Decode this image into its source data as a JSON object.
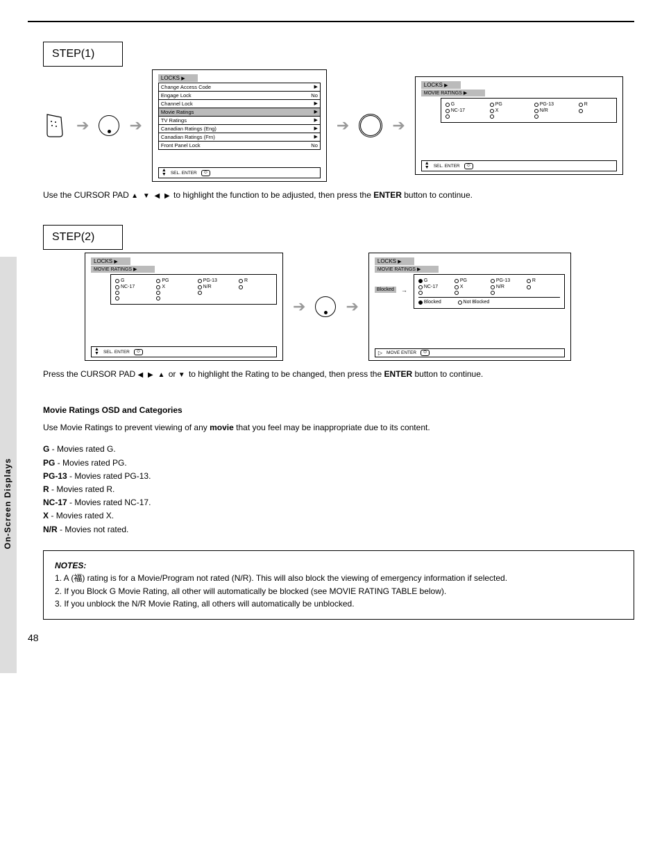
{
  "sideLabel": "On-Screen Displays",
  "pageNumber": "48",
  "step1": {
    "label": "STEP(1)",
    "caption_prefix": "Use the CURSOR PAD",
    "caption_arrows": "▲ ▼ ◀ ▶",
    "caption_mid": "to highlight the function to be adjusted, then press the ",
    "caption_btn": "ENTER",
    "caption_suffix": " button to continue.",
    "menuScreen": {
      "title": "LOCKS",
      "items": [
        {
          "label": "Change Access Code",
          "arrow": "▶"
        },
        {
          "label": "Engage Lock",
          "value": "No"
        },
        {
          "label": "Channel Lock",
          "arrow": "▶"
        },
        {
          "label": "Movie Ratings",
          "arrow": "▶",
          "selected": true
        },
        {
          "label": "TV Ratings",
          "arrow": "▶"
        },
        {
          "label": "Canadian Ratings (Eng)",
          "arrow": "▶"
        },
        {
          "label": "Canadian Ratings (Frn)",
          "arrow": "▶"
        },
        {
          "label": "Front Panel Lock",
          "value": "No"
        }
      ],
      "hint": "SEL.               ENTER"
    },
    "ratingsScreen": {
      "title": "LOCKS",
      "subtitle": "MOVIE RATINGS",
      "rows": [
        [
          {
            "t": "G"
          },
          {
            "t": "PG"
          },
          {
            "t": "PG-13"
          },
          {
            "t": "R"
          }
        ],
        [
          {
            "t": "NC-17"
          },
          {
            "t": "X"
          },
          {
            "t": "N/R"
          },
          {
            "t": ""
          }
        ],
        [
          {
            "t": ""
          },
          {
            "t": ""
          },
          {
            "t": ""
          },
          {
            "t": ""
          }
        ]
      ],
      "hint": "SEL.               ENTER"
    }
  },
  "step2": {
    "label": "STEP(2)",
    "caption_prefix": "Press the CURSOR PAD",
    "caption_arrows": "◀ ▶ ▲",
    "caption_or": "or",
    "caption_arrow2": "▼",
    "caption_mid": " to highlight the Rating to be changed, then press the ",
    "caption_btn": "ENTER",
    "caption_suffix": " button to continue.",
    "screenLeft": {
      "title": "LOCKS",
      "subtitle": "MOVIE RATINGS",
      "rows4": [
        [
          {
            "t": "G"
          },
          {
            "t": "PG"
          },
          {
            "t": "PG-13"
          },
          {
            "t": "R"
          }
        ],
        [
          {
            "t": "NC-17"
          },
          {
            "t": "X"
          },
          {
            "t": "N/R"
          },
          {
            "t": ""
          }
        ],
        [
          {
            "t": ""
          },
          {
            "t": ""
          },
          {
            "t": ""
          },
          {
            "t": ""
          }
        ],
        [
          {
            "t": ""
          },
          {
            "t": ""
          },
          {
            "t": ""
          },
          {
            "t": ""
          }
        ]
      ],
      "hint": "SEL.               ENTER"
    },
    "screenRight": {
      "title": "LOCKS",
      "subtitle": "MOVIE RATINGS",
      "blockedLabel": "Blocked",
      "moveArrow": "→",
      "rows4": [
        [
          {
            "t": "G",
            "on": true
          },
          {
            "t": "PG"
          },
          {
            "t": "PG-13"
          },
          {
            "t": "R"
          }
        ],
        [
          {
            "t": "NC-17"
          },
          {
            "t": "X"
          },
          {
            "t": "N/R"
          },
          {
            "t": ""
          }
        ],
        [
          {
            "t": ""
          },
          {
            "t": ""
          },
          {
            "t": ""
          },
          {
            "t": ""
          }
        ]
      ],
      "statusRow": [
        {
          "t": "Blocked",
          "on": true
        },
        {
          "t": "Not Blocked"
        }
      ],
      "hint": "MOVE               ENTER"
    }
  },
  "movieCategories": {
    "title": "Movie Ratings OSD and Categories",
    "sub_prefix": "Use Movie Ratings to prevent viewing of any ",
    "sub_bold": "movie",
    "sub_suffix": " that you feel may be inappropriate due to its content.",
    "items": [
      {
        "k": "G",
        "v": "Movies rated G."
      },
      {
        "k": "PG",
        "v": "Movies rated PG."
      },
      {
        "k": "PG-13",
        "v": "Movies rated PG-13."
      },
      {
        "k": "R",
        "v": "Movies rated R."
      },
      {
        "k": "NC-17",
        "v": "Movies rated NC-17."
      },
      {
        "k": "X",
        "v": "Movies rated X."
      },
      {
        "k": "N/R",
        "v": "Movies not rated."
      }
    ]
  },
  "notes": {
    "title": "NOTES:",
    "lines": [
      "1. A (福) rating is for a Movie/Program not rated (N/R). This will also block the viewing of emergency information if selected.",
      "2. If you Block G Movie Rating, all other will automatically be blocked (see MOVIE RATING TABLE below).",
      "3. If you unblock the N/R Movie Rating, all others will automatically be unblocked."
    ]
  }
}
